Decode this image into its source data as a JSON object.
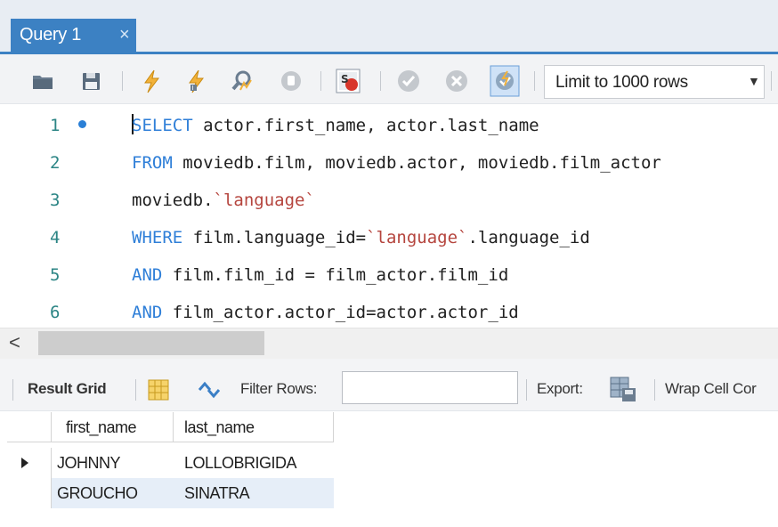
{
  "tab": {
    "title": "Query 1",
    "close": "×"
  },
  "toolbar": {
    "icons": [
      "open-folder-icon",
      "save-icon",
      "execute-icon",
      "execute-current-icon",
      "explain-icon",
      "stop-icon",
      "toggle-errors-icon",
      "commit-icon",
      "rollback-icon",
      "autocommit-icon"
    ],
    "limit_label": "Limit to 1000 rows"
  },
  "editor": {
    "lines": [
      {
        "number": "1",
        "tokens": [
          [
            "kw",
            "SELECT"
          ],
          [
            "txt",
            " actor.first_name, actor.last_name"
          ]
        ]
      },
      {
        "number": "2",
        "tokens": [
          [
            "kw",
            "FROM"
          ],
          [
            "txt",
            " moviedb.film, moviedb.actor, moviedb.film_actor"
          ]
        ]
      },
      {
        "number": "3",
        "tokens": [
          [
            "txt",
            "moviedb."
          ],
          [
            "str",
            "`language`"
          ]
        ]
      },
      {
        "number": "4",
        "tokens": [
          [
            "kw",
            "WHERE"
          ],
          [
            "txt",
            " film.language_id="
          ],
          [
            "str",
            "`language`"
          ],
          [
            "txt",
            ".language_id"
          ]
        ]
      },
      {
        "number": "5",
        "tokens": [
          [
            "kw",
            "AND"
          ],
          [
            "txt",
            " film.film_id = film_actor.film_id"
          ]
        ]
      },
      {
        "number": "6",
        "tokens": [
          [
            "kw",
            "AND"
          ],
          [
            "txt",
            " film_actor.actor_id=actor.actor_id"
          ]
        ]
      }
    ]
  },
  "scrollbar": {
    "left_arrow": "<"
  },
  "result_toolbar": {
    "result_grid": "Result Grid",
    "filter_rows": "Filter Rows:",
    "filter_value": "",
    "export": "Export:",
    "wrap": "Wrap Cell Cor"
  },
  "grid": {
    "columns": [
      "first_name",
      "last_name"
    ],
    "rows": [
      [
        "JOHNNY",
        "LOLLOBRIGIDA"
      ],
      [
        "GROUCHO",
        "SINATRA"
      ]
    ]
  },
  "colors": {
    "accent": "#3c81c3",
    "keyword": "#2f7fd8",
    "string": "#b5453e",
    "line_number": "#2c8585"
  }
}
